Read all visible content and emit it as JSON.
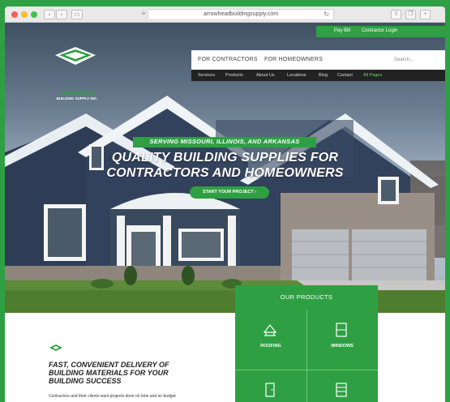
{
  "browser": {
    "url": "arrowheadbuildingsupply.com",
    "back": "‹",
    "forward": "›"
  },
  "utility": {
    "pay_bill": "Pay Bill",
    "contractor_login": "Contractor Login"
  },
  "logo": {
    "name": "ARROWHEAD",
    "subtitle": "BUILDING SUPPLY INC."
  },
  "nav": {
    "for_contractors": "FOR CONTRACTORS",
    "for_homeowners": "FOR HOMEOWNERS",
    "search_placeholder": "Search..."
  },
  "subnav": [
    "Services",
    "Products",
    "About Us",
    "Locations",
    "Blog",
    "Contact",
    "All Pages"
  ],
  "hero": {
    "tagline": "SERVING MISSOURI, ILLINOIS, AND ARKANSAS",
    "headline_line1": "QUALITY BUILDING SUPPLIES FOR",
    "headline_line2": "CONTRACTORS AND HOMEOWNERS",
    "cta": "START YOUR PROJECT  ›"
  },
  "products": {
    "title": "OUR PRODUCTS",
    "items": [
      "ROOFING",
      "WINDOWS"
    ]
  },
  "feature": {
    "title_line1": "FAST, CONVENIENT DELIVERY OF",
    "title_line2": "BUILDING MATERIALS FOR YOUR",
    "title_line3": "BUILDING SUCCESS",
    "body": "Contractors and their clients want projects done on time and on budget"
  },
  "colors": {
    "brand_green": "#2ea043",
    "dark_nav": "#222222"
  }
}
